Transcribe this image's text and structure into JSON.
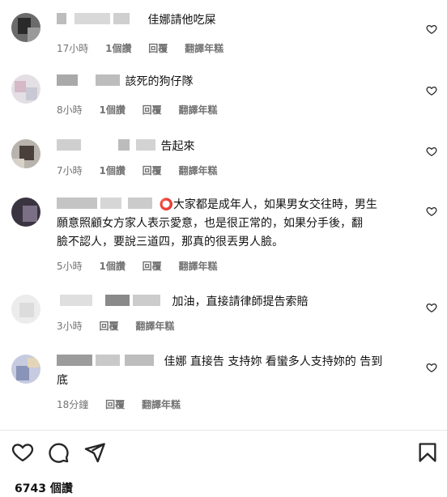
{
  "comments": [
    {
      "text": "佳娜請他吃屎",
      "time": "17小時",
      "likes": "1個讚",
      "reply": "回覆",
      "translate": "翻譯年糕"
    },
    {
      "text": "該死的狗仔隊",
      "time": "8小時",
      "likes": "1個讚",
      "reply": "回覆",
      "translate": "翻譯年糕"
    },
    {
      "text": "告起來",
      "time": "7小時",
      "likes": "1個讚",
      "reply": "回覆",
      "translate": "翻譯年糕"
    },
    {
      "emoji": "⭕",
      "text": "大家都是成年人，如果男女交往時，男生",
      "text2": "願意照顧女方家人表示愛意，也是很正常的，如果分手後，翻",
      "text3": "臉不認人，要說三道四，那真的很丟男人臉。",
      "time": "5小時",
      "likes": "1個讚",
      "reply": "回覆",
      "translate": "翻譯年糕"
    },
    {
      "text": "加油，直接請律師提告索賠",
      "time": "3小時",
      "reply": "回覆",
      "translate": "翻譯年糕"
    },
    {
      "text": "佳娜 直接告 支持妳 看蠻多人支持妳的 告到",
      "text2": "底",
      "time": "18分鐘",
      "reply": "回覆",
      "translate": "翻譯年糕"
    }
  ],
  "footer": {
    "likes_count": "6743 個讚"
  },
  "icons": {
    "heart": "heart-icon",
    "like": "heart-icon",
    "comment": "comment-icon",
    "share": "send-icon",
    "save": "bookmark-icon"
  }
}
